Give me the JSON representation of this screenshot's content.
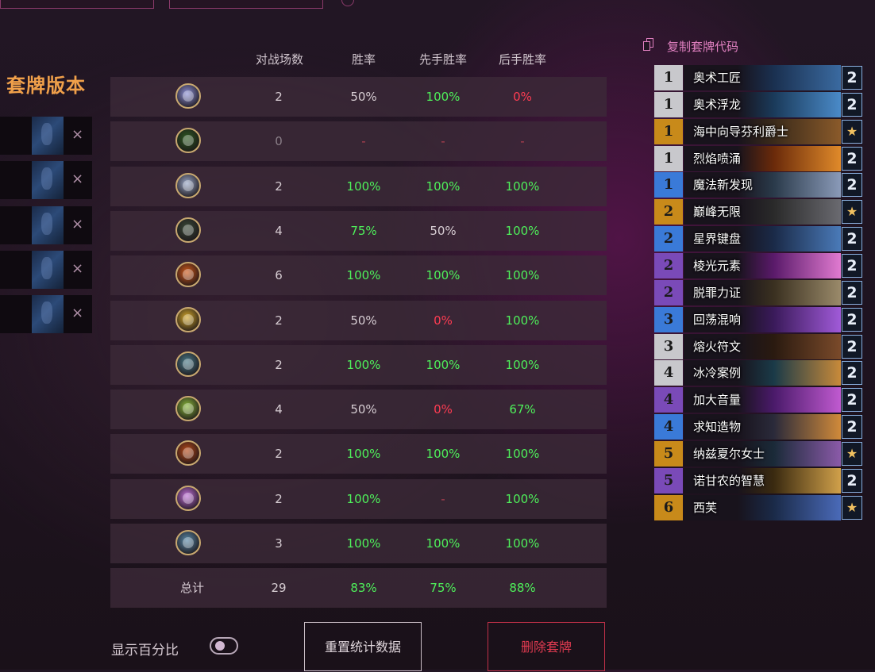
{
  "left_panel": {
    "title": "套牌版本",
    "version_count": 5,
    "remove_glyph": "×"
  },
  "table": {
    "headers": [
      "对战场数",
      "胜率",
      "先手胜率",
      "后手胜率"
    ],
    "rows": [
      {
        "icon": "mage-class-icon",
        "icon_color": "#8e92d8",
        "games": "2",
        "win": "50%",
        "first": "100%",
        "second": "0%"
      },
      {
        "icon": "druid-class-icon",
        "icon_color": "#2e5a22",
        "games": "0",
        "win": "-",
        "first": "-",
        "second": "-"
      },
      {
        "icon": "shaman-class-icon",
        "icon_color": "#9aa8c8",
        "games": "2",
        "win": "100%",
        "first": "100%",
        "second": "100%"
      },
      {
        "icon": "rogue-class-icon",
        "icon_color": "#3a4a38",
        "games": "4",
        "win": "75%",
        "first": "50%",
        "second": "100%"
      },
      {
        "icon": "warrior-class-icon",
        "icon_color": "#d05a1a",
        "games": "6",
        "win": "100%",
        "first": "100%",
        "second": "100%"
      },
      {
        "icon": "paladin-class-icon",
        "icon_color": "#d4a82a",
        "games": "2",
        "win": "50%",
        "first": "0%",
        "second": "100%"
      },
      {
        "icon": "hunter-class-icon",
        "icon_color": "#4a7a88",
        "games": "2",
        "win": "100%",
        "first": "100%",
        "second": "100%"
      },
      {
        "icon": "demon-hunter-class-icon",
        "icon_color": "#8ab83a",
        "games": "4",
        "win": "50%",
        "first": "0%",
        "second": "67%"
      },
      {
        "icon": "warlock-class-icon",
        "icon_color": "#b84a1a",
        "games": "2",
        "win": "100%",
        "first": "100%",
        "second": "100%"
      },
      {
        "icon": "priest-class-icon",
        "icon_color": "#c070d8",
        "games": "2",
        "win": "100%",
        "first": "-",
        "second": "100%"
      },
      {
        "icon": "death-knight-class-icon",
        "icon_color": "#5a8aa8",
        "games": "3",
        "win": "100%",
        "first": "100%",
        "second": "100%"
      }
    ],
    "total": {
      "label": "总计",
      "games": "29",
      "win": "83%",
      "first": "75%",
      "second": "88%"
    }
  },
  "controls": {
    "show_percent_label": "显示百分比",
    "show_percent_enabled": true,
    "reset_label": "重置统计数据",
    "delete_label": "删除套牌"
  },
  "deck": {
    "copy_code_label": "复制套牌代码",
    "cards": [
      {
        "cost": "1",
        "name": "奥术工匠",
        "count": "2",
        "rarity_color": "#c8c8cc",
        "art": [
          "#1a3050",
          "#3a6aa0"
        ]
      },
      {
        "cost": "1",
        "name": "奥术浮龙",
        "count": "2",
        "rarity_color": "#c8c8cc",
        "art": [
          "#1a3a5a",
          "#4a8ac8"
        ]
      },
      {
        "cost": "1",
        "name": "海中向导芬利爵士",
        "count": "★",
        "rarity_color": "#c88a1a",
        "art": [
          "#3a2a1a",
          "#8a5a2a"
        ]
      },
      {
        "cost": "1",
        "name": "烈焰喷涌",
        "count": "2",
        "rarity_color": "#c8c8cc",
        "art": [
          "#6a2a0a",
          "#e08a2a"
        ]
      },
      {
        "cost": "1",
        "name": "魔法新发现",
        "count": "2",
        "rarity_color": "#3a7ad8",
        "art": [
          "#2a3a4a",
          "#8a9ab8"
        ]
      },
      {
        "cost": "2",
        "name": "巅峰无限",
        "count": "★",
        "rarity_color": "#c88a1a",
        "art": [
          "#2a2a2a",
          "#6a6a70"
        ]
      },
      {
        "cost": "2",
        "name": "星界键盘",
        "count": "2",
        "rarity_color": "#3a7ad8",
        "art": [
          "#1a2a48",
          "#4a7ab8"
        ]
      },
      {
        "cost": "2",
        "name": "棱光元素",
        "count": "2",
        "rarity_color": "#7a4ab8",
        "art": [
          "#5a1a6a",
          "#e07ad0"
        ]
      },
      {
        "cost": "2",
        "name": "脱罪力证",
        "count": "2",
        "rarity_color": "#7a4ab8",
        "art": [
          "#3a3020",
          "#9a8a6a"
        ]
      },
      {
        "cost": "3",
        "name": "回荡混响",
        "count": "2",
        "rarity_color": "#3a7ad8",
        "art": [
          "#3a1a5a",
          "#a05ad8"
        ]
      },
      {
        "cost": "3",
        "name": "熔火符文",
        "count": "2",
        "rarity_color": "#c8c8cc",
        "art": [
          "#2a1a10",
          "#7a4a2a"
        ]
      },
      {
        "cost": "4",
        "name": "冰冷案例",
        "count": "2",
        "rarity_color": "#c8c8cc",
        "art": [
          "#1a3a48",
          "#c88a3a"
        ]
      },
      {
        "cost": "4",
        "name": "加大音量",
        "count": "2",
        "rarity_color": "#7a4ab8",
        "art": [
          "#4a1a6a",
          "#c05ad0"
        ]
      },
      {
        "cost": "4",
        "name": "求知造物",
        "count": "2",
        "rarity_color": "#3a7ad8",
        "art": [
          "#2a2a3a",
          "#d08a3a"
        ]
      },
      {
        "cost": "5",
        "name": "纳兹夏尔女士",
        "count": "★",
        "rarity_color": "#c88a1a",
        "art": [
          "#1a2a38",
          "#8a5aa8"
        ]
      },
      {
        "cost": "5",
        "name": "诺甘农的智慧",
        "count": "2",
        "rarity_color": "#7a4ab8",
        "art": [
          "#3a2a10",
          "#d0a04a"
        ]
      },
      {
        "cost": "6",
        "name": "西芙",
        "count": "★",
        "rarity_color": "#c88a1a",
        "art": [
          "#1a2a48",
          "#4a6ab8"
        ]
      }
    ]
  }
}
